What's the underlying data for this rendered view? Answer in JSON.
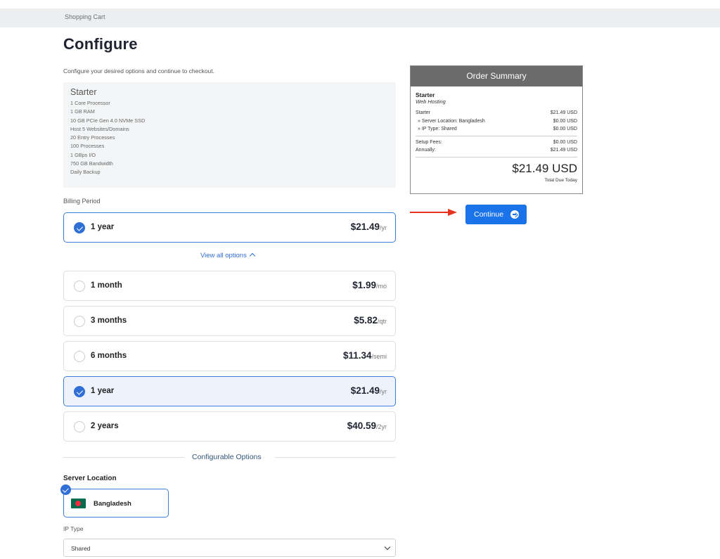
{
  "breadcrumb": "Shopping Cart",
  "title": "Configure",
  "subtitle": "Configure your desired options and continue to checkout.",
  "product": {
    "name": "Starter",
    "features": [
      "1 Core Processor",
      "1 GB RAM",
      "10 GB PCIe Gen 4.0 NVMe SSD",
      "Host 5 Websites/Domains",
      "20 Entry Processes",
      "100 Processes",
      "1 GBps I/O",
      "750 GB Bandwidth",
      "Daily Backup"
    ]
  },
  "billing": {
    "label": "Billing Period",
    "selected": {
      "name": "1 year",
      "price": "$21.49",
      "suffix": "/yr"
    },
    "view_all": "View all options",
    "options": [
      {
        "name": "1 month",
        "price": "$1.99",
        "suffix": "/mo",
        "checked": false
      },
      {
        "name": "3 months",
        "price": "$5.82",
        "suffix": "/qtr",
        "checked": false
      },
      {
        "name": "6 months",
        "price": "$11.34",
        "suffix": "/semi",
        "checked": false
      },
      {
        "name": "1 year",
        "price": "$21.49",
        "suffix": "/yr",
        "checked": true
      },
      {
        "name": "2 years",
        "price": "$40.59",
        "suffix": "/2yr",
        "checked": false
      }
    ]
  },
  "configurable": {
    "title": "Configurable Options",
    "server_location_label": "Server Location",
    "server_location_value": "Bangladesh",
    "ip_type_label": "IP Type",
    "ip_type_value": "Shared"
  },
  "summary": {
    "header": "Order Summary",
    "product": "Starter",
    "group": "Web Hosting",
    "lines": [
      {
        "label": "Starter",
        "amount": "$21.49 USD"
      },
      {
        "label": "» Server Location: Bangladesh",
        "amount": "$0.00 USD"
      },
      {
        "label": "» IP Type: Shared",
        "amount": "$0.00 USD"
      }
    ],
    "setup_label": "Setup Fees:",
    "setup_amount": "$0.00 USD",
    "annual_label": "Annually:",
    "annual_amount": "$21.49 USD",
    "total": "$21.49 USD",
    "due_label": "Total Due Today"
  },
  "continue_label": "Continue",
  "colors": {
    "accent": "#1a73e8",
    "selected_border": "#3d7fd9",
    "arrow": "#e8321e",
    "summary_header": "#6b6b6b"
  }
}
